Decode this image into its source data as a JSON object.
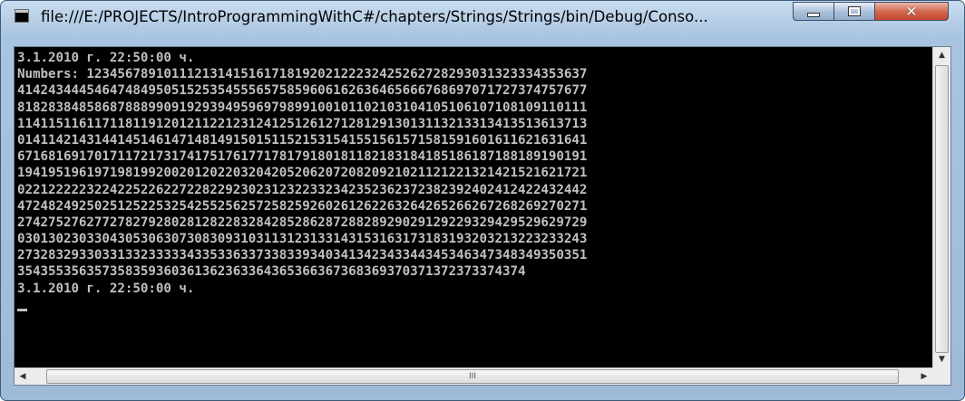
{
  "window": {
    "title": "file:///E:/PROJECTS/IntroProgrammingWithC#/chapters/Strings/Strings/bin/Debug/Conso...",
    "buttons": {
      "minimize": "minimize-icon",
      "maximize": "maximize-icon",
      "close": "close-icon"
    }
  },
  "console": {
    "lines": [
      "3.1.2010 г. 22:50:00 ч.",
      "Numbers: 12345678910111213141516171819202122232425262728293031323334353637",
      "41424344454647484950515253545556575859606162636465666768697071727374757677",
      "81828384858687888990919293949596979899100101102103104105106107108109110111",
      "11411511611711811912012112212312412512612712812913013113213313413513613713",
      "01411421431441451461471481491501511521531541551561571581591601611621631641",
      "67168169170171172173174175176177178179180181182183184185186187188189190191",
      "19419519619719819920020120220320420520620720820921021121221321421521621721",
      "02212222232242252262272282292302312322332342352362372382392402412422432442",
      "47248249250251252253254255256257258259260261262263264265266267268269270271",
      "27427527627727827928028128228328428528628728828929029129229329429529629729",
      "03013023033043053063073083093103113123133143153163173183193203213223233243",
      "27328329330331332333334335336337338339340341342343344345346347348349350351",
      "354355356357358359360361362363364365366367368369370371372373374374",
      "3.1.2010 г. 22:50:00 ч."
    ]
  },
  "scrollbars": {
    "vertical": {
      "up_arrow": "▲",
      "down_arrow": "▼"
    },
    "horizontal": {
      "left_arrow": "◀",
      "right_arrow": "▶",
      "thumb_grip": "III"
    }
  }
}
